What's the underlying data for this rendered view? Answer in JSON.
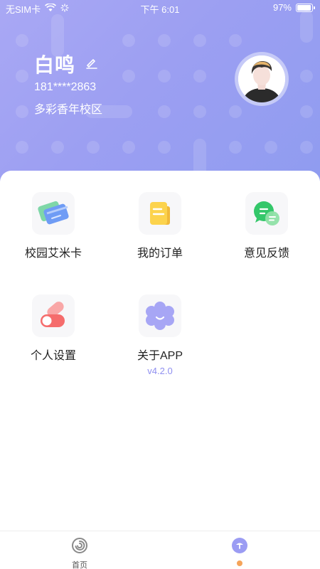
{
  "status_bar": {
    "carrier": "无SIM卡",
    "time": "下午 6:01",
    "battery": "97%",
    "battery_level": 0.97
  },
  "profile": {
    "name": "白鸣",
    "phone": "181****2863",
    "campus": "多彩香年校区"
  },
  "menu": {
    "items": [
      {
        "label": "校园艾米卡",
        "icon": "card-icon"
      },
      {
        "label": "我的订单",
        "icon": "order-icon"
      },
      {
        "label": "意见反馈",
        "icon": "chat-icon"
      },
      {
        "label": "个人设置",
        "icon": "toggle-icon"
      },
      {
        "label": "关于APP",
        "icon": "flower-face-icon",
        "sub": "v4.2.0"
      }
    ]
  },
  "tabbar": {
    "items": [
      {
        "label": "首页",
        "icon": "swirl-icon"
      },
      {
        "label": "",
        "icon": "profile-tab-icon"
      }
    ]
  },
  "colors": {
    "header_gradient_start": "#a9a8f4",
    "header_gradient_end": "#8f9cf0",
    "accent": "#8f8ff0",
    "active_dot": "#f5a45a"
  }
}
